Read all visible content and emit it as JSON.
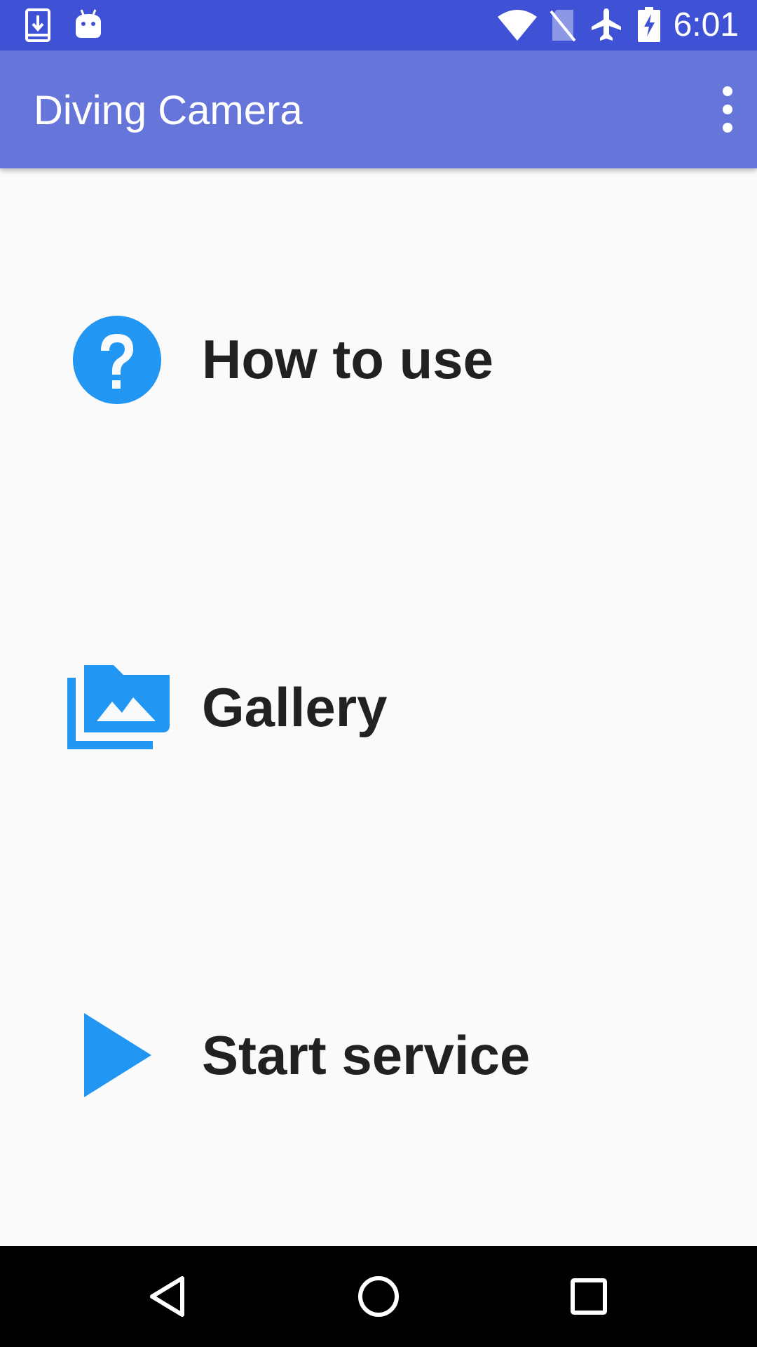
{
  "status_bar": {
    "time": "6:01",
    "icons": [
      "download-notification-icon",
      "android-notification-icon",
      "wifi-icon",
      "no-sim-icon",
      "airplane-mode-icon",
      "battery-charging-icon"
    ],
    "background": "#3f51d5"
  },
  "app_bar": {
    "title": "Diving Camera",
    "background": "#6675d9",
    "overflow_icon": "more-vertical-icon"
  },
  "menu": {
    "accent": "#2196f3",
    "items": [
      {
        "label": "How to use",
        "icon": "help-circle-icon"
      },
      {
        "label": "Gallery",
        "icon": "photo-library-icon"
      },
      {
        "label": "Start service",
        "icon": "play-icon"
      }
    ]
  },
  "nav_bar": {
    "buttons": [
      "back-icon",
      "home-icon",
      "recents-icon"
    ],
    "background": "#000000"
  }
}
